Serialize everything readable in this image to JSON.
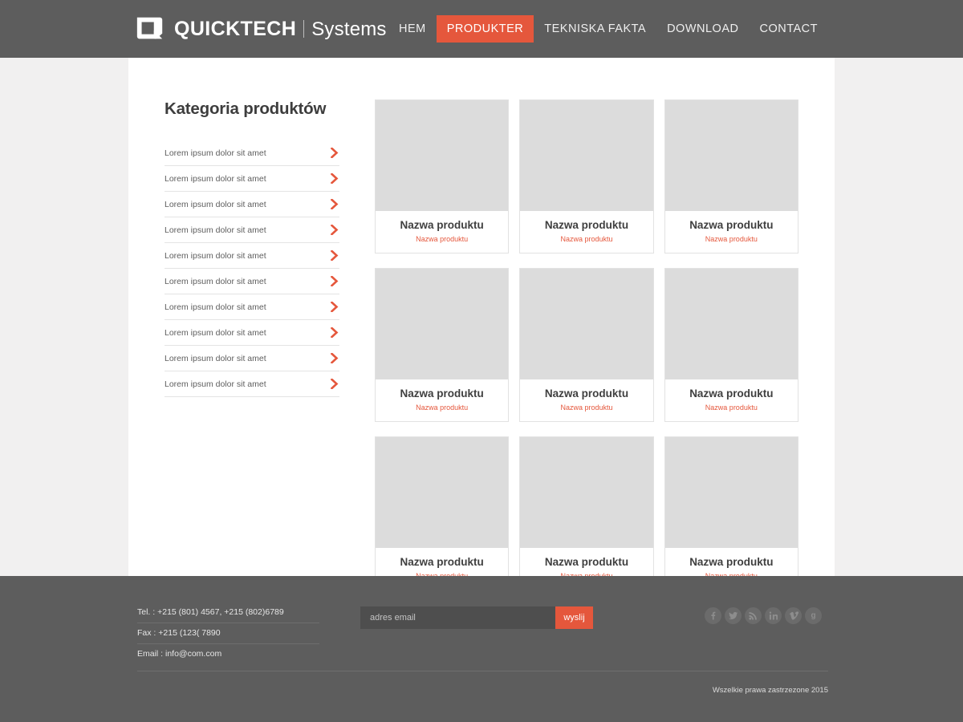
{
  "header": {
    "brand": {
      "mark_icon": "quicktech-q-logo-icon",
      "name": "QUICKTECH",
      "separator": "|",
      "sub": "Systems"
    },
    "nav": [
      {
        "label": "HEM",
        "active": false
      },
      {
        "label": "PRODUKTER",
        "active": true
      },
      {
        "label": "TEKNISKA FAKTA",
        "active": false
      },
      {
        "label": "DOWNLOAD",
        "active": false
      },
      {
        "label": "CONTACT",
        "active": false
      }
    ]
  },
  "sidebar": {
    "title": "Kategoria produktów",
    "arrow_icon": "chevron-right-icon",
    "items": [
      {
        "label": "Lorem ipsum dolor sit amet"
      },
      {
        "label": "Lorem ipsum dolor sit amet"
      },
      {
        "label": "Lorem ipsum dolor sit amet"
      },
      {
        "label": "Lorem ipsum dolor sit amet"
      },
      {
        "label": "Lorem ipsum dolor sit amet"
      },
      {
        "label": "Lorem ipsum dolor sit amet"
      },
      {
        "label": "Lorem ipsum dolor sit amet"
      },
      {
        "label": "Lorem ipsum dolor sit amet"
      },
      {
        "label": "Lorem ipsum dolor sit amet"
      },
      {
        "label": "Lorem ipsum dolor sit amet"
      }
    ]
  },
  "products": [
    {
      "title": "Nazwa produktu",
      "subtitle": "Nazwa produktu",
      "image": "placeholder"
    },
    {
      "title": "Nazwa produktu",
      "subtitle": "Nazwa produktu",
      "image": "placeholder"
    },
    {
      "title": "Nazwa produktu",
      "subtitle": "Nazwa produktu",
      "image": "placeholder"
    },
    {
      "title": "Nazwa produktu",
      "subtitle": "Nazwa produktu",
      "image": "placeholder"
    },
    {
      "title": "Nazwa produktu",
      "subtitle": "Nazwa produktu",
      "image": "placeholder"
    },
    {
      "title": "Nazwa produktu",
      "subtitle": "Nazwa produktu",
      "image": "placeholder"
    },
    {
      "title": "Nazwa produktu",
      "subtitle": "Nazwa produktu",
      "image": "placeholder"
    },
    {
      "title": "Nazwa produktu",
      "subtitle": "Nazwa produktu",
      "image": "placeholder"
    },
    {
      "title": "Nazwa produktu",
      "subtitle": "Nazwa produktu",
      "image": "placeholder"
    }
  ],
  "footer": {
    "contact": [
      {
        "text": "Tel. : +215 (801) 4567, +215 (802)6789"
      },
      {
        "text": "Fax : +215 (123( 7890"
      },
      {
        "text": "Email : info@com.com"
      }
    ],
    "newsletter": {
      "placeholder": "adres email",
      "value": "",
      "button_label": "wyslij"
    },
    "socials": [
      {
        "name": "facebook-icon",
        "glyph": "f"
      },
      {
        "name": "twitter-icon",
        "glyph": "t"
      },
      {
        "name": "rss-icon",
        "glyph": "r"
      },
      {
        "name": "linkedin-icon",
        "glyph": "in"
      },
      {
        "name": "vimeo-icon",
        "glyph": "v"
      },
      {
        "name": "google-plus-icon",
        "glyph": "g"
      }
    ],
    "copyright": "Wszelkie prawa zastrzezone 2015"
  },
  "colors": {
    "accent": "#e5573c",
    "header_bg": "#5d5d5d",
    "footer_bg": "#5d5d5d",
    "page_bg": "#f1f0f0",
    "sheet_bg": "#ffffff",
    "thumb_bg": "#dcdcdc"
  }
}
